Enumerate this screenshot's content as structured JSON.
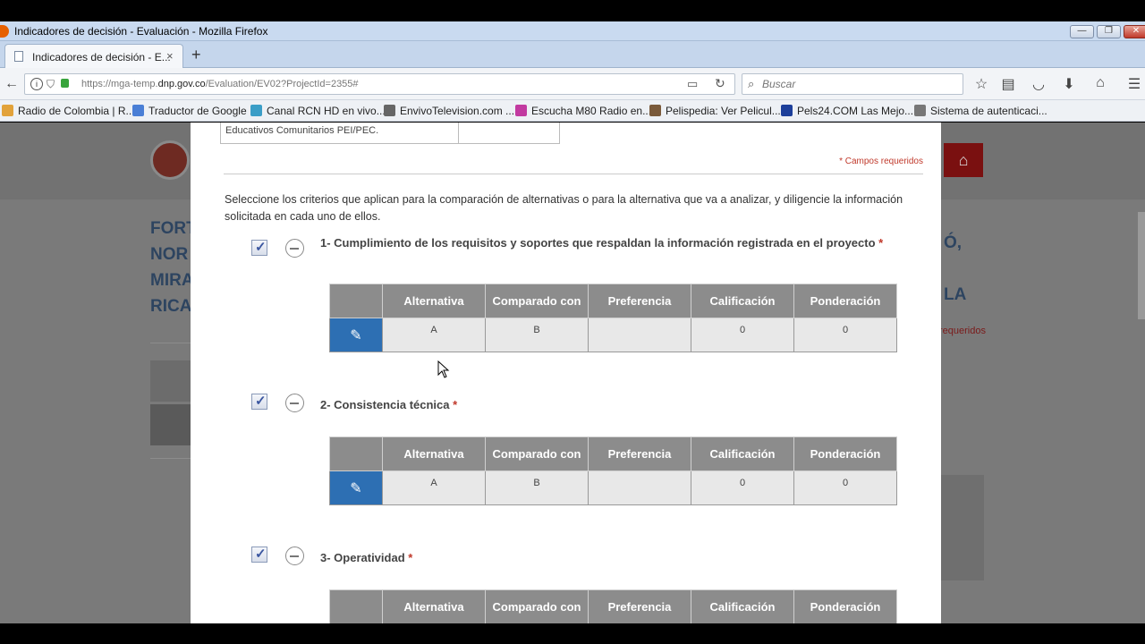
{
  "window": {
    "title": "Indicadores de decisión - Evaluación - Mozilla Firefox"
  },
  "tab": {
    "label": "Indicadores de decisión - E...",
    "close": "×",
    "new": "+"
  },
  "nav": {
    "url_prefix": "https://mga-temp.",
    "url_domain": "dnp.gov.co",
    "url_path": "/Evaluation/EV02?ProjectId=2355#",
    "search_placeholder": "Buscar"
  },
  "bookmarks": [
    {
      "label": "Radio de Colombia | R...",
      "color": "#e2a23a"
    },
    {
      "label": "Traductor de Google",
      "color": "#4a7fd6"
    },
    {
      "label": "Canal RCN HD en vivo...",
      "color": "#3b9ec7"
    },
    {
      "label": "EnvivoTelevision.com ...",
      "color": "#666666"
    },
    {
      "label": "Escucha M80 Radio en...",
      "color": "#c23aa0"
    },
    {
      "label": "Pelispedia: Ver Pelicul...",
      "color": "#7a5a3a"
    },
    {
      "label": "Pels24.COM Las Mejo...",
      "color": "#1d3f9a"
    },
    {
      "label": "Sistema de autenticaci...",
      "color": "#777777"
    }
  ],
  "background": {
    "title_lines": [
      "FORT",
      "NOR",
      "MIRA",
      "RICA"
    ],
    "right_lines": [
      "Ó,",
      "",
      "LA"
    ],
    "requeridos": "requeridos"
  },
  "modal": {
    "edu_text": "Educativos Comunitarios PEI/PEC.",
    "required_note": "* Campos requeridos",
    "intro": "Seleccione los criterios que aplican para la comparación de alternativas o para la alternativa que va a analizar, y diligencie la información solicitada en cada uno de ellos.",
    "required_star": "*",
    "columns": [
      "Alternativa",
      "Comparado con",
      "Preferencia",
      "Calificación",
      "Ponderación"
    ],
    "criteria": [
      {
        "title": "1- Cumplimiento de los requisitos y soportes que respaldan la información registrada en el proyecto",
        "row": {
          "alternativa": "A",
          "comparado": "B",
          "preferencia": "",
          "calificacion": "0",
          "ponderacion": "0"
        }
      },
      {
        "title": "2- Consistencia técnica",
        "row": {
          "alternativa": "A",
          "comparado": "B",
          "preferencia": "",
          "calificacion": "0",
          "ponderacion": "0"
        }
      },
      {
        "title": "3- Operatividad",
        "row": null
      }
    ]
  },
  "colors": {
    "header_gray": "#8c8c8c",
    "edit_blue": "#2d6fb3",
    "required_red": "#c0392b"
  }
}
